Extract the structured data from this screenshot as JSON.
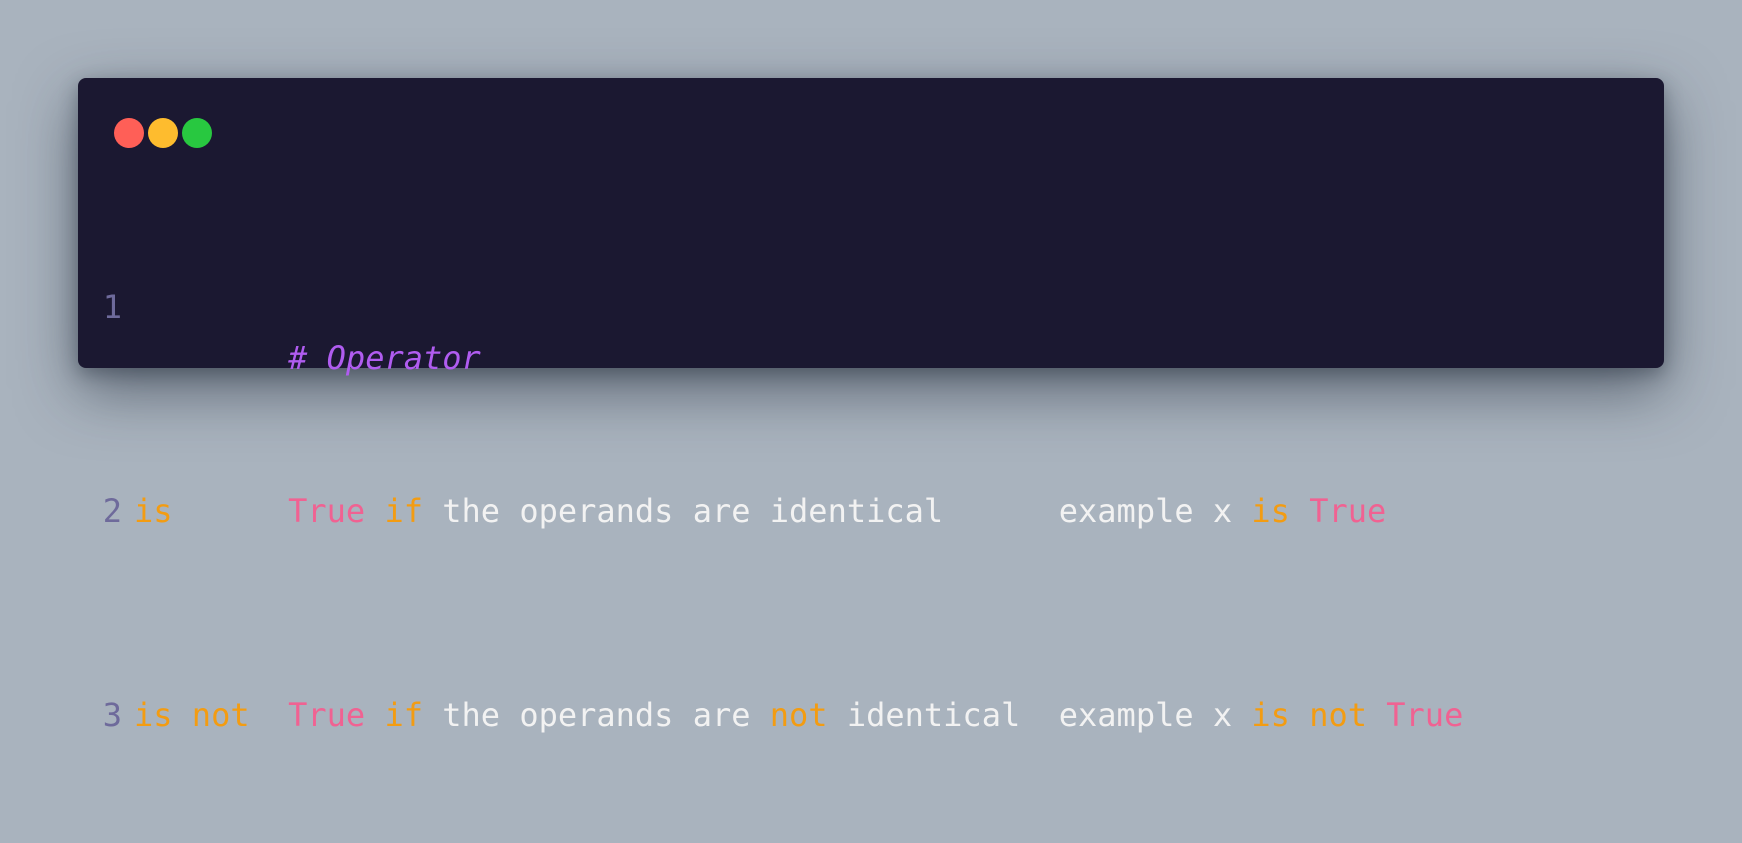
{
  "window_controls": [
    {
      "name": "close",
      "color": "#ff5f57"
    },
    {
      "name": "minimize",
      "color": "#febc2e"
    },
    {
      "name": "maximize",
      "color": "#28c840"
    }
  ],
  "colors": {
    "background": "#a9b3be",
    "editor_bg": "#1b1831",
    "line_number": "#6e6a9b",
    "comment": "#b05cf0",
    "keyword": "#f39c12",
    "boolean": "#f06292",
    "text": "#f2f2f2"
  },
  "code": {
    "lines": [
      {
        "number": "1",
        "tokens": [
          {
            "text": "# Operator",
            "type": "comment"
          }
        ]
      },
      {
        "number": "2",
        "tokens": [
          {
            "text": "is",
            "type": "kw"
          },
          {
            "text": "      ",
            "type": "plain"
          },
          {
            "text": "True",
            "type": "true"
          },
          {
            "text": " ",
            "type": "plain"
          },
          {
            "text": "if",
            "type": "kw"
          },
          {
            "text": " the operands are identical      example x ",
            "type": "plain"
          },
          {
            "text": "is",
            "type": "kw"
          },
          {
            "text": " ",
            "type": "plain"
          },
          {
            "text": "True",
            "type": "true"
          }
        ]
      },
      {
        "number": "3",
        "tokens": [
          {
            "text": "is",
            "type": "kw"
          },
          {
            "text": " ",
            "type": "plain"
          },
          {
            "text": "not",
            "type": "kw"
          },
          {
            "text": "  ",
            "type": "plain"
          },
          {
            "text": "True",
            "type": "true"
          },
          {
            "text": " ",
            "type": "plain"
          },
          {
            "text": "if",
            "type": "kw"
          },
          {
            "text": " the operands are ",
            "type": "plain"
          },
          {
            "text": "not",
            "type": "kw"
          },
          {
            "text": " identical  example x ",
            "type": "plain"
          },
          {
            "text": "is",
            "type": "kw"
          },
          {
            "text": " ",
            "type": "plain"
          },
          {
            "text": "not",
            "type": "kw"
          },
          {
            "text": " ",
            "type": "plain"
          },
          {
            "text": "True",
            "type": "true"
          }
        ]
      }
    ]
  }
}
